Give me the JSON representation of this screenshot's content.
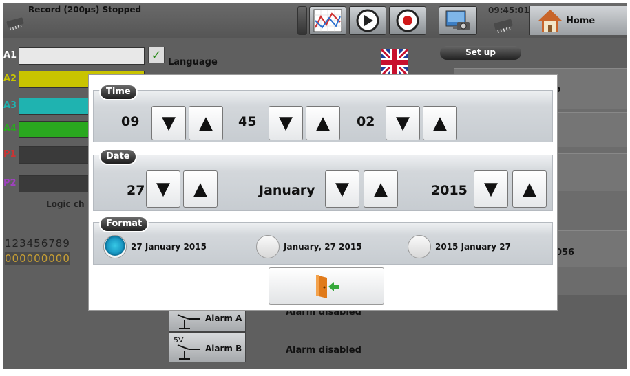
{
  "topbar": {
    "record_status": "Record (200µs) Stopped",
    "clock": "09:45:01",
    "home_label": "Home"
  },
  "background": {
    "channels": [
      {
        "label": "A1",
        "color": "#e8e8e8",
        "label_color": "#ffffff"
      },
      {
        "label": "A2",
        "color": "#c9c400",
        "label_color": "#c9c400"
      },
      {
        "label": "A3",
        "color": "#1fb3b0",
        "label_color": "#1fb3b0"
      },
      {
        "label": "A4",
        "color": "#2aa81f",
        "label_color": "#2aa81f"
      },
      {
        "label": "P1",
        "color": "#3a3a3a",
        "label_color": "#cc3333"
      },
      {
        "label": "P2",
        "color": "#3a3a3a",
        "label_color": "#a040c0"
      }
    ],
    "language_label": "Language",
    "setup_tab": "Set up",
    "logic_label": "Logic ch",
    "digits_top": "123456789",
    "digits_bottom": "000000000",
    "value_right": ".056",
    "partial_right": "p",
    "alarm_a": {
      "voltage": "5V",
      "name": "Alarm  A",
      "status": "Alarm disabled"
    },
    "alarm_b": {
      "voltage": "5V",
      "name": "Alarm  B",
      "status": "Alarm disabled"
    }
  },
  "dialog": {
    "time": {
      "title": "Time",
      "hours": "09",
      "minutes": "45",
      "seconds": "02"
    },
    "date": {
      "title": "Date",
      "day": "27",
      "month": "January",
      "year": "2015"
    },
    "format": {
      "title": "Format",
      "options": [
        {
          "label": "27 January 2015",
          "selected": true
        },
        {
          "label": "January, 27 2015",
          "selected": false
        },
        {
          "label": "2015 January 27",
          "selected": false
        }
      ]
    },
    "down_glyph": "▼",
    "up_glyph": "▲",
    "exit_icon": "exit-door-icon"
  }
}
